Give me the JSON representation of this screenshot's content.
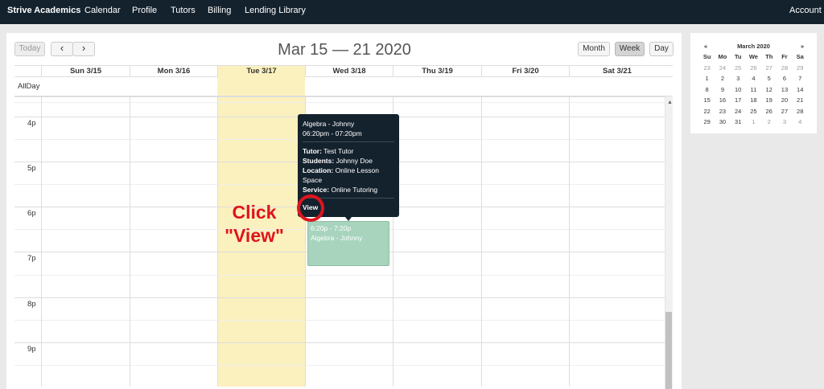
{
  "nav": {
    "brand": "Strive Academics",
    "items": [
      "Calendar",
      "Profile",
      "Tutors",
      "Billing",
      "Lending Library"
    ],
    "account": "Account"
  },
  "toolbar": {
    "today": "Today",
    "prev": "‹",
    "next": "›",
    "title": "Mar 15 — 21 2020",
    "views": [
      "Month",
      "Week",
      "Day"
    ],
    "active_view": "Week"
  },
  "calendar": {
    "days": [
      "Sun 3/15",
      "Mon 3/16",
      "Tue 3/17",
      "Wed 3/18",
      "Thu 3/19",
      "Fri 3/20",
      "Sat 3/21"
    ],
    "allday_label": "AllDay",
    "times": [
      "4p",
      "5p",
      "6p",
      "7p",
      "8p",
      "9p"
    ],
    "today_index": 2,
    "today_color": "#fbf1bf"
  },
  "event": {
    "time": "6:20p - 7:20p",
    "title": "Algebra - Johnny",
    "color": "#a8d4bd"
  },
  "tooltip": {
    "title": "Algebra - Johnny",
    "time": "06:20pm - 07:20pm",
    "fields": [
      {
        "label": "Tutor:",
        "value": "Test Tutor"
      },
      {
        "label": "Students:",
        "value": "Johnny Doe"
      },
      {
        "label": "Location:",
        "value": "Online Lesson Space"
      },
      {
        "label": "Service:",
        "value": "Online Tutoring"
      }
    ],
    "view": "View"
  },
  "annotation": {
    "line1": "Click",
    "line2": "\"View\"",
    "color": "#e0141c"
  },
  "mini_calendar": {
    "prev": "«",
    "next": "»",
    "month": "March 2020",
    "weekdays": [
      "Su",
      "Mo",
      "Tu",
      "We",
      "Th",
      "Fr",
      "Sa"
    ],
    "weeks": [
      [
        {
          "d": "23",
          "o": true
        },
        {
          "d": "24",
          "o": true
        },
        {
          "d": "25",
          "o": true
        },
        {
          "d": "26",
          "o": true
        },
        {
          "d": "27",
          "o": true
        },
        {
          "d": "28",
          "o": true
        },
        {
          "d": "29",
          "o": true
        }
      ],
      [
        {
          "d": "1"
        },
        {
          "d": "2"
        },
        {
          "d": "3"
        },
        {
          "d": "4"
        },
        {
          "d": "5"
        },
        {
          "d": "6"
        },
        {
          "d": "7"
        }
      ],
      [
        {
          "d": "8"
        },
        {
          "d": "9"
        },
        {
          "d": "10"
        },
        {
          "d": "11"
        },
        {
          "d": "12"
        },
        {
          "d": "13"
        },
        {
          "d": "14"
        }
      ],
      [
        {
          "d": "15"
        },
        {
          "d": "16"
        },
        {
          "d": "17"
        },
        {
          "d": "18"
        },
        {
          "d": "19"
        },
        {
          "d": "20"
        },
        {
          "d": "21"
        }
      ],
      [
        {
          "d": "22"
        },
        {
          "d": "23"
        },
        {
          "d": "24"
        },
        {
          "d": "25"
        },
        {
          "d": "26"
        },
        {
          "d": "27"
        },
        {
          "d": "28"
        }
      ],
      [
        {
          "d": "29"
        },
        {
          "d": "30"
        },
        {
          "d": "31"
        },
        {
          "d": "1",
          "o": true
        },
        {
          "d": "2",
          "o": true
        },
        {
          "d": "3",
          "o": true
        },
        {
          "d": "4",
          "o": true
        }
      ]
    ]
  }
}
